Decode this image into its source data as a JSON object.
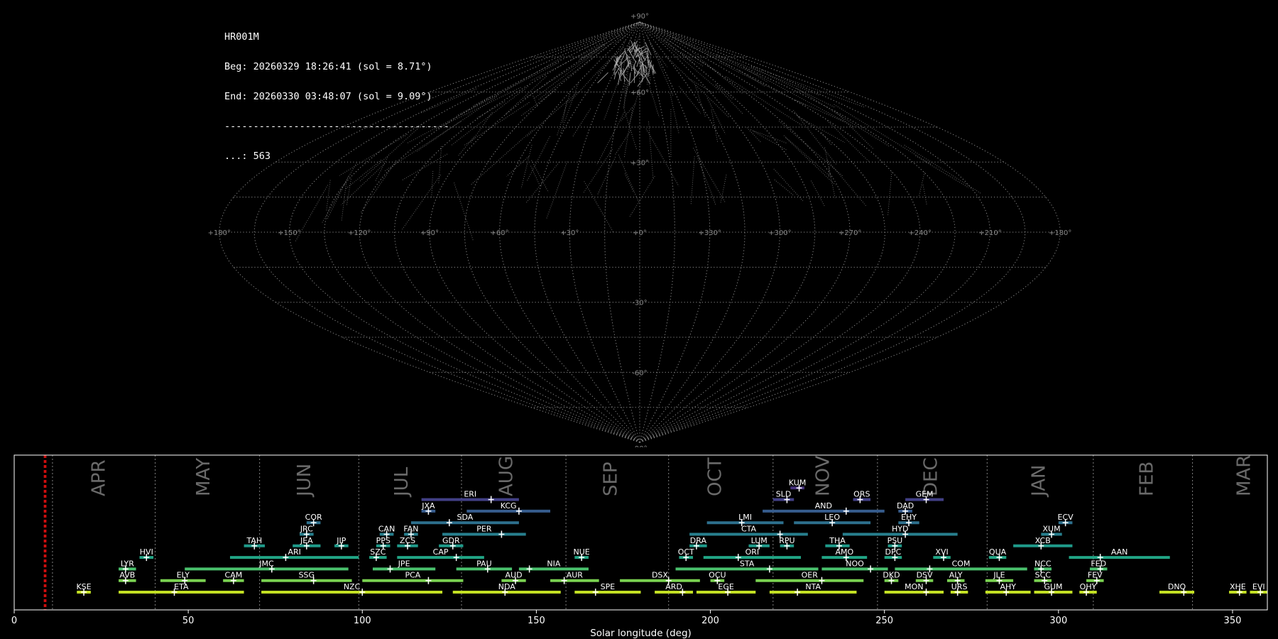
{
  "header": {
    "station": "HR001M",
    "begin": "Beg: 20260329 18:26:41 (sol = 8.71°)",
    "end": "End: 20260330 03:48:07 (sol = 9.09°)",
    "separator": "---------------------------------------",
    "count": "...: 563"
  },
  "colors": {
    "background": "#000000",
    "grid": "#8a8a8a",
    "meteor_trails": "#9a9a9a",
    "axis": "#ffffff",
    "month_label": "#6a6a6a",
    "current_marker": "#e01010"
  },
  "sky_map": {
    "projection": "sinusoidal",
    "lon_labels": [
      "+180°",
      "+150°",
      "+120°",
      "+90°",
      "+60°",
      "+30°",
      "+0°",
      "+330°",
      "+300°",
      "+270°",
      "+240°",
      "+210°",
      "+180°"
    ],
    "lon_values": [
      180,
      150,
      120,
      90,
      60,
      30,
      0,
      -30,
      -60,
      -90,
      -120,
      -150,
      -180
    ],
    "lat_labels": [
      "+90°",
      "+60°",
      "+30°",
      "-30°",
      "-60°",
      "-90°"
    ],
    "lat_values": [
      90,
      60,
      30,
      -30,
      -60,
      -90
    ],
    "center_label": "+0°"
  },
  "chart_data": {
    "type": "timeline",
    "xlabel": "Solar longitude (deg)",
    "xlim": [
      0,
      360
    ],
    "xticks": [
      0,
      50,
      100,
      150,
      200,
      250,
      300,
      350
    ],
    "current_solar_longitude": [
      8.71,
      9.09
    ],
    "month_boundaries": [
      11,
      40.5,
      70.5,
      99,
      128.5,
      158.5,
      188,
      218,
      248,
      279.5,
      310,
      338.5
    ],
    "months": [
      {
        "label": "APR",
        "x": 24
      },
      {
        "label": "MAY",
        "x": 54
      },
      {
        "label": "JUN",
        "x": 83
      },
      {
        "label": "JUL",
        "x": 111
      },
      {
        "label": "AUG",
        "x": 141
      },
      {
        "label": "SEP",
        "x": 171
      },
      {
        "label": "OCT",
        "x": 201
      },
      {
        "label": "NOV",
        "x": 232
      },
      {
        "label": "DEC",
        "x": 263
      },
      {
        "label": "JAN",
        "x": 294
      },
      {
        "label": "FEB",
        "x": 325
      },
      {
        "label": "MAR",
        "x": 353
      }
    ],
    "showers": [
      {
        "code": "KUM",
        "row": 10,
        "start": 223,
        "end": 227,
        "peak": 225.5
      },
      {
        "code": "SLD",
        "row": 9,
        "start": 218,
        "end": 224,
        "peak": 222
      },
      {
        "code": "ORS",
        "row": 9,
        "start": 241,
        "end": 246,
        "peak": 243
      },
      {
        "code": "GEM",
        "row": 9,
        "start": 256,
        "end": 267,
        "peak": 262
      },
      {
        "code": "ERI",
        "row": 9,
        "start": 117,
        "end": 145,
        "peak": 137
      },
      {
        "code": "JXA",
        "row": 8,
        "start": 117,
        "end": 121,
        "peak": 119
      },
      {
        "code": "KCG",
        "row": 8,
        "start": 130,
        "end": 154,
        "peak": 145
      },
      {
        "code": "AND",
        "row": 8,
        "start": 215,
        "end": 250,
        "peak": 239
      },
      {
        "code": "DAD",
        "row": 8,
        "start": 254,
        "end": 258,
        "peak": 256
      },
      {
        "code": "COR",
        "row": 7,
        "start": 84,
        "end": 88,
        "peak": 86
      },
      {
        "code": "SDA",
        "row": 7,
        "start": 114,
        "end": 145,
        "peak": 125
      },
      {
        "code": "LMI",
        "row": 7,
        "start": 199,
        "end": 221,
        "peak": 209
      },
      {
        "code": "LEO",
        "row": 7,
        "start": 224,
        "end": 246,
        "peak": 235
      },
      {
        "code": "EHY",
        "row": 7,
        "start": 254,
        "end": 260,
        "peak": 257
      },
      {
        "code": "ECV",
        "row": 7,
        "start": 300,
        "end": 304,
        "peak": 302
      },
      {
        "code": "JRC",
        "row": 6,
        "start": 82,
        "end": 86,
        "peak": 84
      },
      {
        "code": "CAN",
        "row": 6,
        "start": 105,
        "end": 109,
        "peak": 107
      },
      {
        "code": "FAN",
        "row": 6,
        "start": 112,
        "end": 116,
        "peak": 114
      },
      {
        "code": "PER",
        "row": 6,
        "start": 123,
        "end": 147,
        "peak": 140
      },
      {
        "code": "CTA",
        "row": 6,
        "start": 194,
        "end": 228,
        "peak": 220
      },
      {
        "code": "HYD",
        "row": 6,
        "start": 238,
        "end": 271,
        "peak": 256
      },
      {
        "code": "XUM",
        "row": 6,
        "start": 295,
        "end": 301,
        "peak": 298
      },
      {
        "code": "TAH",
        "row": 5,
        "start": 66,
        "end": 72,
        "peak": 69
      },
      {
        "code": "JEA",
        "row": 5,
        "start": 80,
        "end": 88,
        "peak": 84
      },
      {
        "code": "JIP",
        "row": 5,
        "start": 92,
        "end": 96,
        "peak": 94
      },
      {
        "code": "PPS",
        "row": 5,
        "start": 104,
        "end": 108,
        "peak": 106
      },
      {
        "code": "ZCS",
        "row": 5,
        "start": 110,
        "end": 116,
        "peak": 113
      },
      {
        "code": "GDR",
        "row": 5,
        "start": 122,
        "end": 129,
        "peak": 126
      },
      {
        "code": "DRA",
        "row": 5,
        "start": 194,
        "end": 199,
        "peak": 196
      },
      {
        "code": "LUM",
        "row": 5,
        "start": 211,
        "end": 217,
        "peak": 214
      },
      {
        "code": "RPU",
        "row": 5,
        "start": 220,
        "end": 224,
        "peak": 222
      },
      {
        "code": "THA",
        "row": 5,
        "start": 233,
        "end": 240,
        "peak": 237
      },
      {
        "code": "PSU",
        "row": 5,
        "start": 251,
        "end": 255,
        "peak": 253
      },
      {
        "code": "XCB",
        "row": 5,
        "start": 287,
        "end": 304,
        "peak": 295
      },
      {
        "code": "HVI",
        "row": 4,
        "start": 36,
        "end": 40,
        "peak": 38
      },
      {
        "code": "ARI",
        "row": 4,
        "start": 62,
        "end": 99,
        "peak": 78
      },
      {
        "code": "SZC",
        "row": 4,
        "start": 102,
        "end": 107,
        "peak": 104
      },
      {
        "code": "CAP",
        "row": 4,
        "start": 110,
        "end": 135,
        "peak": 127
      },
      {
        "code": "NUE",
        "row": 4,
        "start": 161,
        "end": 165,
        "peak": 163
      },
      {
        "code": "OCT",
        "row": 4,
        "start": 191,
        "end": 195,
        "peak": 193
      },
      {
        "code": "ORI",
        "row": 4,
        "start": 198,
        "end": 226,
        "peak": 208
      },
      {
        "code": "AMO",
        "row": 4,
        "start": 232,
        "end": 245,
        "peak": 239
      },
      {
        "code": "DPC",
        "row": 4,
        "start": 250,
        "end": 255,
        "peak": 253
      },
      {
        "code": "XVI",
        "row": 4,
        "start": 264,
        "end": 269,
        "peak": 267
      },
      {
        "code": "QUA",
        "row": 4,
        "start": 280,
        "end": 285,
        "peak": 283
      },
      {
        "code": "AAN",
        "row": 4,
        "start": 303,
        "end": 332,
        "peak": 312
      },
      {
        "code": "LYR",
        "row": 3,
        "start": 30,
        "end": 35,
        "peak": 32
      },
      {
        "code": "JMC",
        "row": 3,
        "start": 49,
        "end": 96,
        "peak": 74
      },
      {
        "code": "JPE",
        "row": 3,
        "start": 103,
        "end": 121,
        "peak": 108
      },
      {
        "code": "PAU",
        "row": 3,
        "start": 127,
        "end": 143,
        "peak": 136
      },
      {
        "code": "NIA",
        "row": 3,
        "start": 145,
        "end": 165,
        "peak": 148
      },
      {
        "code": "STA",
        "row": 3,
        "start": 190,
        "end": 231,
        "peak": 217
      },
      {
        "code": "NOO",
        "row": 3,
        "start": 232,
        "end": 251,
        "peak": 246
      },
      {
        "code": "COM",
        "row": 3,
        "start": 253,
        "end": 291,
        "peak": 263
      },
      {
        "code": "NCC",
        "row": 3,
        "start": 293,
        "end": 298,
        "peak": 295
      },
      {
        "code": "FED",
        "row": 3,
        "start": 309,
        "end": 314,
        "peak": 312
      },
      {
        "code": "AVB",
        "row": 2,
        "start": 30,
        "end": 35,
        "peak": 32
      },
      {
        "code": "ELY",
        "row": 2,
        "start": 42,
        "end": 55,
        "peak": 49
      },
      {
        "code": "CAM",
        "row": 2,
        "start": 60,
        "end": 66,
        "peak": 63
      },
      {
        "code": "SSG",
        "row": 2,
        "start": 71,
        "end": 97,
        "peak": 86
      },
      {
        "code": "PCA",
        "row": 2,
        "start": 100,
        "end": 129,
        "peak": 119
      },
      {
        "code": "AUD",
        "row": 2,
        "start": 140,
        "end": 147,
        "peak": 144
      },
      {
        "code": "AUR",
        "row": 2,
        "start": 154,
        "end": 168,
        "peak": 158
      },
      {
        "code": "DSX",
        "row": 2,
        "start": 174,
        "end": 197,
        "peak": 188
      },
      {
        "code": "OCU",
        "row": 2,
        "start": 200,
        "end": 204,
        "peak": 202
      },
      {
        "code": "OER",
        "row": 2,
        "start": 213,
        "end": 244,
        "peak": 232
      },
      {
        "code": "DKD",
        "row": 2,
        "start": 250,
        "end": 254,
        "peak": 252
      },
      {
        "code": "DSV",
        "row": 2,
        "start": 259,
        "end": 264,
        "peak": 262
      },
      {
        "code": "ALY",
        "row": 2,
        "start": 268,
        "end": 273,
        "peak": 271
      },
      {
        "code": "JLE",
        "row": 2,
        "start": 279,
        "end": 287,
        "peak": 283
      },
      {
        "code": "SCC",
        "row": 2,
        "start": 293,
        "end": 298,
        "peak": 296
      },
      {
        "code": "FEV",
        "row": 2,
        "start": 308,
        "end": 313,
        "peak": 311
      },
      {
        "code": "KSE",
        "row": 1,
        "start": 18,
        "end": 22,
        "peak": 20
      },
      {
        "code": "ETA",
        "row": 1,
        "start": 30,
        "end": 66,
        "peak": 46
      },
      {
        "code": "NZC",
        "row": 1,
        "start": 71,
        "end": 123,
        "peak": 100
      },
      {
        "code": "NDA",
        "row": 1,
        "start": 126,
        "end": 157,
        "peak": 141
      },
      {
        "code": "SPE",
        "row": 1,
        "start": 161,
        "end": 180,
        "peak": 167
      },
      {
        "code": "ARD",
        "row": 1,
        "start": 184,
        "end": 195,
        "peak": 192
      },
      {
        "code": "EGE",
        "row": 1,
        "start": 196,
        "end": 213,
        "peak": 205
      },
      {
        "code": "NTA",
        "row": 1,
        "start": 217,
        "end": 242,
        "peak": 225
      },
      {
        "code": "MON",
        "row": 1,
        "start": 250,
        "end": 267,
        "peak": 262
      },
      {
        "code": "URS",
        "row": 1,
        "start": 269,
        "end": 274,
        "peak": 271
      },
      {
        "code": "AHY",
        "row": 1,
        "start": 279,
        "end": 292,
        "peak": 285
      },
      {
        "code": "GUM",
        "row": 1,
        "start": 293,
        "end": 304,
        "peak": 298
      },
      {
        "code": "OHY",
        "row": 1,
        "start": 306,
        "end": 311,
        "peak": 308
      },
      {
        "code": "DNO",
        "row": 1,
        "start": 329,
        "end": 339,
        "peak": 336
      },
      {
        "code": "XHE",
        "row": 1,
        "start": 349,
        "end": 354,
        "peak": 352
      },
      {
        "code": "EVI",
        "row": 1,
        "start": 355,
        "end": 360,
        "peak": 358
      }
    ]
  }
}
